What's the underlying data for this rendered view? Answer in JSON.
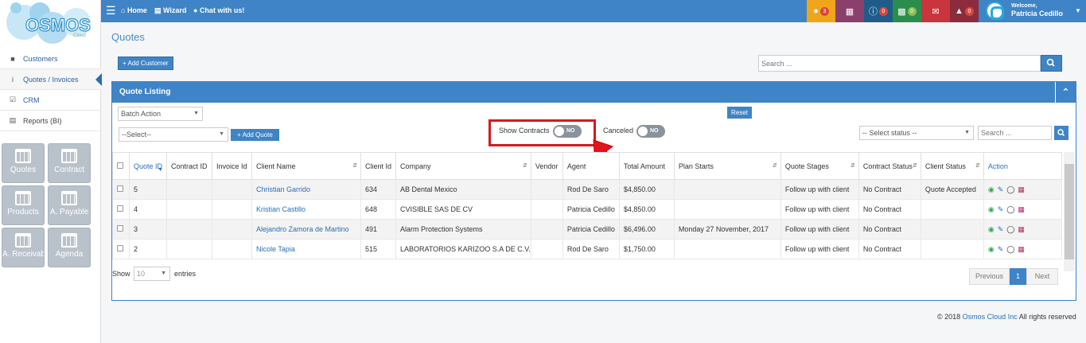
{
  "logo": {
    "text": "OSMOS",
    "subtext": "Cloud"
  },
  "sidebar": {
    "items": [
      {
        "label": "Customers",
        "icon": "user-icon"
      },
      {
        "label": "Quotes / Invoices",
        "icon": "info-icon"
      },
      {
        "label": "CRM",
        "icon": "check-square-icon"
      },
      {
        "label": "Reports (BI)",
        "icon": "bar-chart-icon"
      }
    ],
    "tiles": [
      "Quotes",
      "Contract",
      "Products",
      "A. Payable",
      "A. Receivab",
      "Agenda"
    ]
  },
  "topbar": {
    "home": "Home",
    "wizard": "Wizard",
    "chat": "Chat with us!",
    "badges": [
      {
        "name": "lightbulb-icon",
        "count": "3",
        "bg": "#f0a61b",
        "badge": "#d9473a"
      },
      {
        "name": "calendar-icon",
        "count": "",
        "bg": "#8a3f6d",
        "badge": ""
      },
      {
        "name": "info-circle-icon",
        "count": "0",
        "bg": "#1f5c8a",
        "badge": "#d9473a"
      },
      {
        "name": "comments-icon",
        "count": "0",
        "bg": "#2b8d4d",
        "badge": "#8cc152"
      },
      {
        "name": "envelope-icon",
        "count": "",
        "bg": "#c9353d",
        "badge": ""
      },
      {
        "name": "bell-icon",
        "count": "0",
        "bg": "#8c2b3c",
        "badge": "#d9473a"
      }
    ],
    "welcome": "Welcome,",
    "user": "Patricia Cedillo"
  },
  "page": {
    "title": "Quotes",
    "add_customer": "+ Add Customer",
    "search_placeholder": "Search ..."
  },
  "panel": {
    "title": "Quote Listing",
    "batch_action": "Batch Action",
    "select": "--Select--",
    "add_quote": "+ Add Quote",
    "reset": "Reset",
    "show_contracts": "Show Contracts",
    "canceled": "Canceled",
    "switch_off": "NO",
    "select_status": "-- Select status --",
    "search_placeholder": "Search ..."
  },
  "table": {
    "columns": [
      "Quote ID",
      "Contract ID",
      "Invoice Id",
      "Client Name",
      "Client Id",
      "Company",
      "Vendor",
      "Agent",
      "Total Amount",
      "Plan Starts",
      "Quote Stages",
      "Contract Status",
      "Client Status",
      "Action"
    ],
    "rows": [
      {
        "quote_id": "5",
        "contract_id": "",
        "invoice_id": "",
        "client_name": "Christian Garrido",
        "client_id": "634",
        "company": "AB Dental Mexico",
        "vendor": "",
        "agent": "Rod De Saro",
        "total": "$4,850.00",
        "plan_starts": "",
        "stage": "Follow up with client",
        "contract_status": "No Contract",
        "client_status": "Quote Accepted"
      },
      {
        "quote_id": "4",
        "contract_id": "",
        "invoice_id": "",
        "client_name": "Kristian Castillo",
        "client_id": "648",
        "company": "CVISIBLE SAS DE CV",
        "vendor": "",
        "agent": "Patricia Cedillo",
        "total": "$4,850.00",
        "plan_starts": "",
        "stage": "Follow up with client",
        "contract_status": "No Contract",
        "client_status": ""
      },
      {
        "quote_id": "3",
        "contract_id": "",
        "invoice_id": "",
        "client_name": "Alejandro Zamora de Martino",
        "client_id": "491",
        "company": "Alarm Protection Systems",
        "vendor": "",
        "agent": "Patricia Cedillo",
        "total": "$6,496.00",
        "plan_starts": "Monday 27 November, 2017",
        "stage": "Follow up with client",
        "contract_status": "No Contract",
        "client_status": ""
      },
      {
        "quote_id": "2",
        "contract_id": "",
        "invoice_id": "",
        "client_name": "Nicole Tapia",
        "client_id": "515",
        "company": "LABORATORIOS KARIZOO S.A DE C.V.",
        "vendor": "",
        "agent": "Rod De Saro",
        "total": "$1,750.00",
        "plan_starts": "",
        "stage": "Follow up with client",
        "contract_status": "No Contract",
        "client_status": ""
      }
    ]
  },
  "pagination": {
    "show": "Show",
    "entries_value": "10",
    "entries": "entries",
    "previous": "Previous",
    "page": "1",
    "next": "Next"
  },
  "footer": {
    "year": "© 2018",
    "company": "Osmos Cloud Inc",
    "rights": "All rights reserved"
  },
  "colors": {
    "primary": "#3e84c6",
    "highlight": "#d7191c"
  }
}
